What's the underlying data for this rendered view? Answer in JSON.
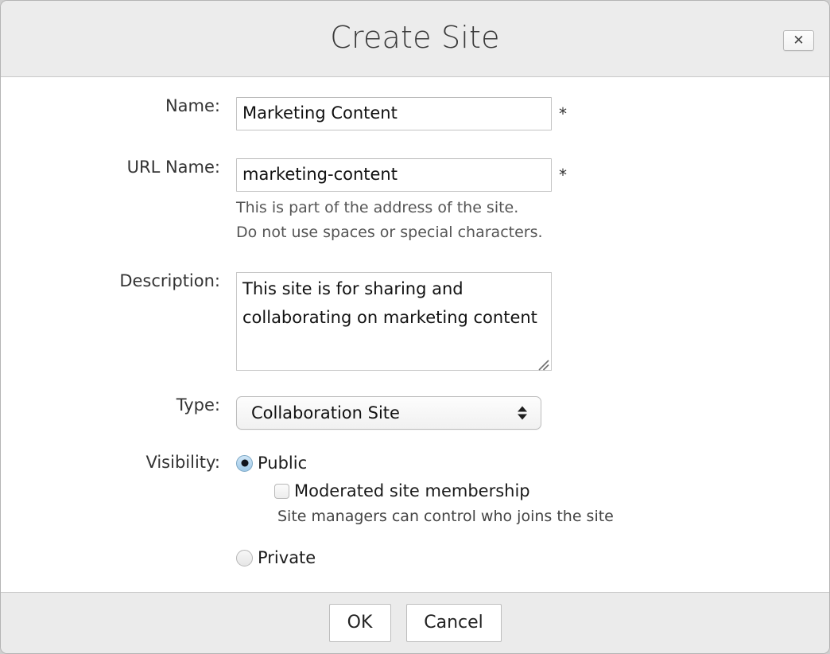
{
  "dialog": {
    "title": "Create Site",
    "close_icon": "close-icon",
    "close_glyph": "✕"
  },
  "form": {
    "name": {
      "label": "Name:",
      "value": "Marketing Content",
      "placeholder": "",
      "required_marker": "*"
    },
    "url_name": {
      "label": "URL Name:",
      "value": "marketing-content",
      "placeholder": "",
      "required_marker": "*",
      "hint_line_1": "This is part of the address of the site.",
      "hint_line_2": "Do not use spaces or special characters."
    },
    "description": {
      "label": "Description:",
      "value": "This site is for sharing and collaborating on marketing content",
      "placeholder": "",
      "resize_icon": "resize-handle-icon"
    },
    "type": {
      "label": "Type:",
      "selected": "Collaboration Site",
      "options": [
        "Collaboration Site"
      ],
      "arrows_icon": "stepper-arrows-icon"
    },
    "visibility": {
      "label": "Visibility:",
      "public": {
        "label": "Public",
        "selected": true
      },
      "moderated": {
        "label": "Moderated site membership",
        "checked": false,
        "hint": "Site managers can control who joins the site"
      },
      "private": {
        "label": "Private",
        "selected": false
      }
    }
  },
  "footer": {
    "ok_label": "OK",
    "cancel_label": "Cancel"
  },
  "colors": {
    "header_bg": "#ececec",
    "footer_bg": "#ebebeb",
    "body_bg": "#ffffff",
    "border": "#c8c8c8",
    "radio_accent": "#9fc9e8",
    "text": "#333333"
  }
}
